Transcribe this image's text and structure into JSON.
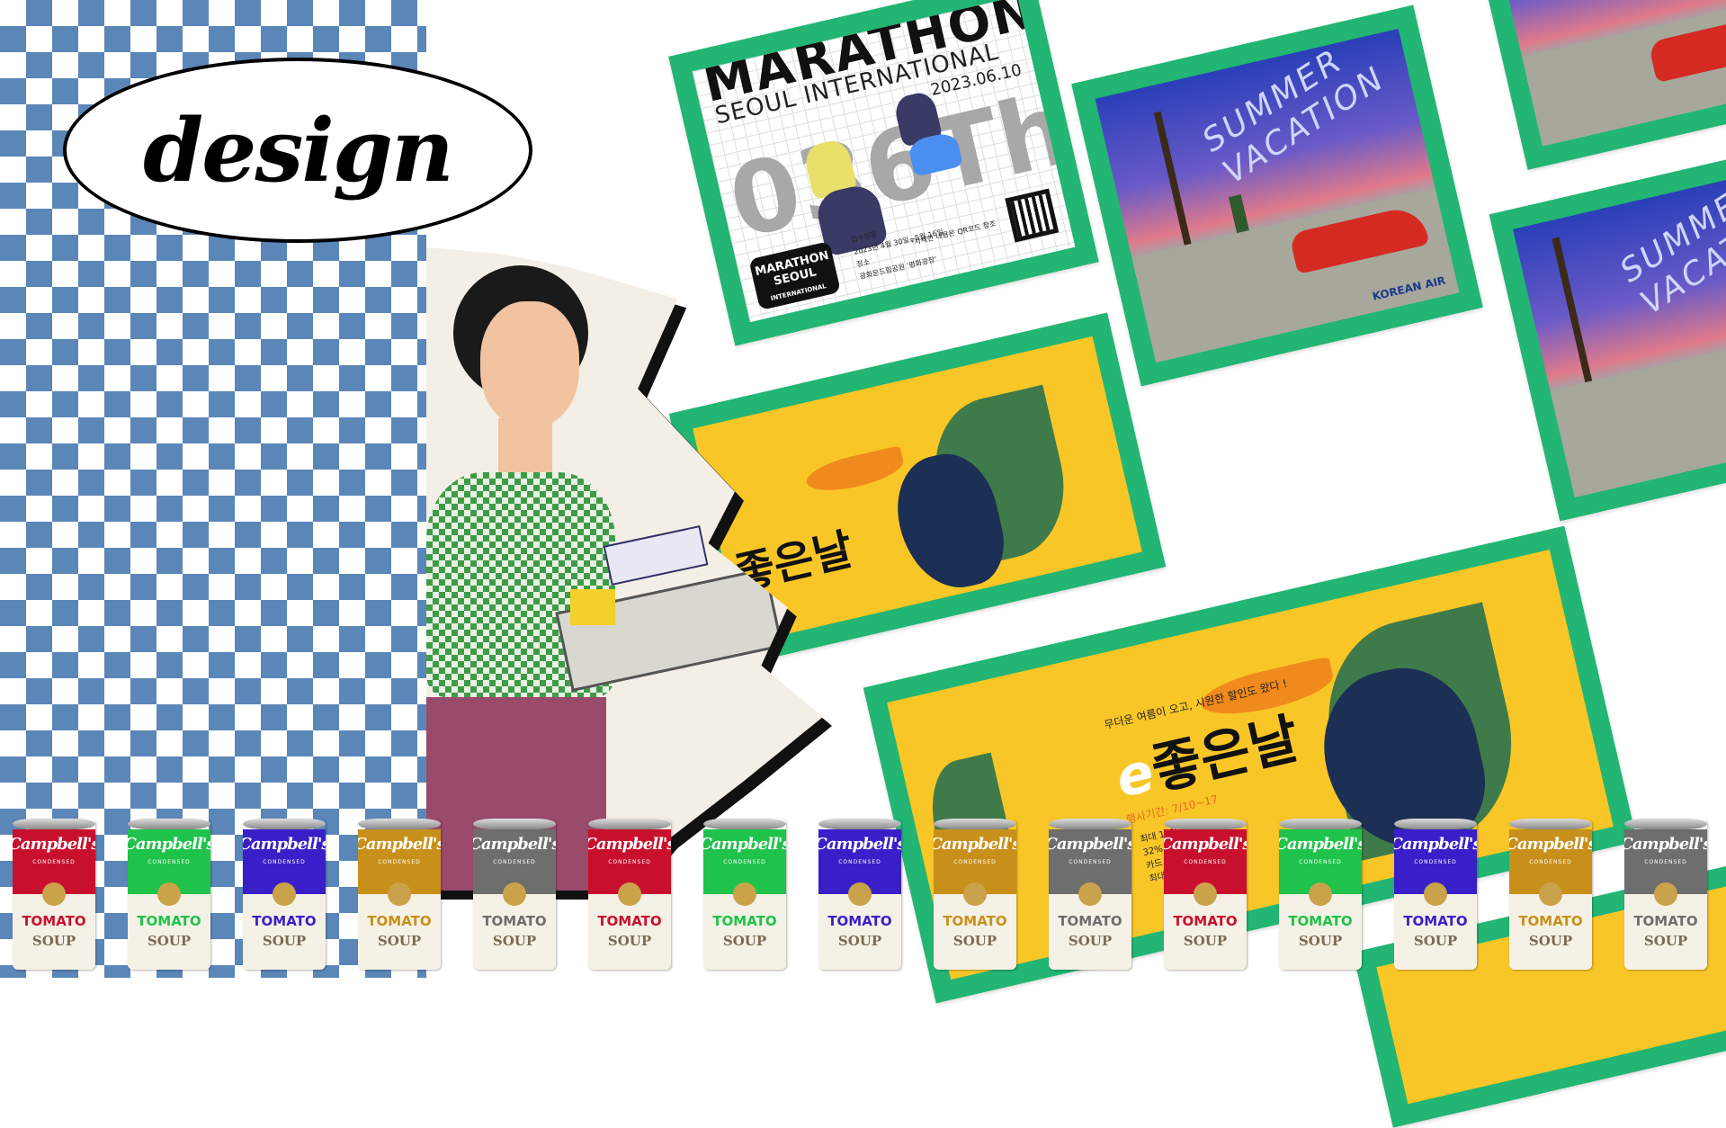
{
  "logo": {
    "text": "design"
  },
  "marathon": {
    "title": "MARATHON",
    "subtitle": "SEOUL INTERNATIONAL",
    "date": "2023.06.10",
    "edition": "036Th",
    "logo_text": "MARATHON SEOUL",
    "logo_sub": "INTERNATIONAL",
    "info_label": "접수일정",
    "info_dates": "2023년 4월 30일~5월 16일",
    "place_label": "장소",
    "place": "광화문드림공원 '평화광장'",
    "note": "*자세한 내용은 QR코드 참조"
  },
  "summer": {
    "title_1": "SUMMER",
    "title_2": "VACATION",
    "brand": "KOREAN AIR"
  },
  "toucan": {
    "tagline": "무더운 여름이 오고, 시원한 할인도 왔다 !",
    "title_e": "e",
    "title": "좋은날",
    "period": "행사기간: 7/10~17",
    "items": [
      "최대 11%",
      "32%",
      "카드 청구 할인",
      "최대 5% 추가 적립"
    ]
  },
  "cans": {
    "brand": "Campbell's",
    "condensed": "CONDENSED",
    "variety": "TOMATO",
    "soup": "SOUP",
    "colors": [
      "#c8102e",
      "#1fc24a",
      "#3a1fc8",
      "#c8901a",
      "#6e6e6e",
      "#c8102e",
      "#1fc24a",
      "#3a1fc8",
      "#c8901a",
      "#6e6e6e",
      "#c8102e",
      "#1fc24a",
      "#3a1fc8",
      "#c8901a",
      "#6e6e6e"
    ]
  },
  "colors": {
    "card_border": "#22b573",
    "checker": "#5b86b8",
    "banner": "#f9c627"
  }
}
